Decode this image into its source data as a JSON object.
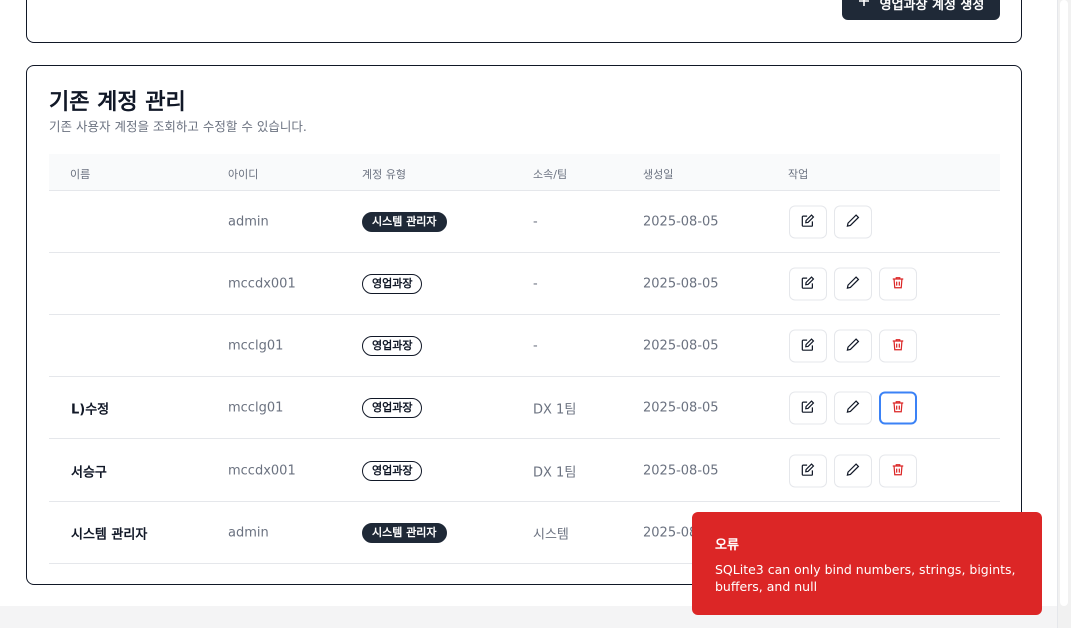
{
  "create_button": {
    "icon": "plus-icon",
    "label": "영업과장 계정 생성"
  },
  "section": {
    "title": "기존 계정 관리",
    "subtitle": "기존 사용자 계정을 조회하고 수정할 수 있습니다."
  },
  "table": {
    "headers": [
      "이름",
      "아이디",
      "계정 유형",
      "소속/팀",
      "생성일",
      "작업"
    ],
    "rows": [
      {
        "name": "",
        "id": "admin",
        "type": "시스템 관리자",
        "type_style": "admin",
        "team": "-",
        "created": "2025-08-05",
        "deletable": false
      },
      {
        "name": "",
        "id": "mccdx001",
        "type": "영업과장",
        "type_style": "mgr",
        "team": "-",
        "created": "2025-08-05",
        "deletable": true
      },
      {
        "name": "",
        "id": "mcclg01",
        "type": "영업과장",
        "type_style": "mgr",
        "team": "-",
        "created": "2025-08-05",
        "deletable": true
      },
      {
        "name": "L)수정",
        "id": "mcclg01",
        "type": "영업과장",
        "type_style": "mgr",
        "team": "DX 1팀",
        "created": "2025-08-05",
        "deletable": true,
        "focused_delete": true
      },
      {
        "name": "서승구",
        "id": "mccdx001",
        "type": "영업과장",
        "type_style": "mgr",
        "team": "DX 1팀",
        "created": "2025-08-05",
        "deletable": true
      },
      {
        "name": "시스템 관리자",
        "id": "admin",
        "type": "시스템 관리자",
        "type_style": "admin",
        "team": "시스템",
        "created": "2025-08-05",
        "deletable": false
      }
    ]
  },
  "toast": {
    "title": "오류",
    "message": "SQLite3 can only bind numbers, strings, bigints, buffers, and null"
  },
  "colors": {
    "primary": "#1f2937",
    "danger": "#dc2626",
    "focus": "#3b82f6"
  }
}
